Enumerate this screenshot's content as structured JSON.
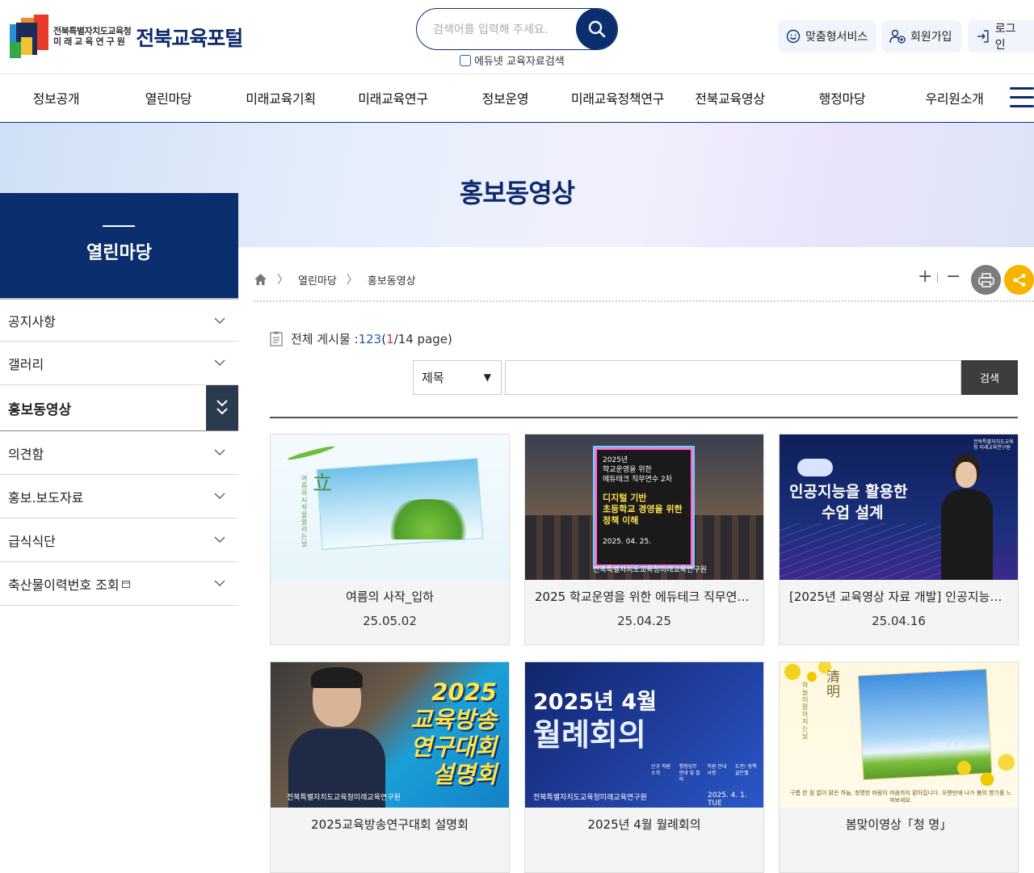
{
  "header": {
    "logo_org_line1": "전북특별자치도교육청",
    "logo_org_line2": "미래교육연구원",
    "logo_title": "전북교육포털",
    "search_placeholder": "검색어를 입력해 주세요.",
    "edunet_label": "에듀넷 교육자료검색",
    "util": {
      "custom_service": "맞춤형서비스",
      "join": "회원가입",
      "login": "로그인"
    }
  },
  "gnb": [
    "정보공개",
    "열린마당",
    "미래교육기획",
    "미래교육연구",
    "정보운영",
    "미래교육정책연구",
    "전북교육영상",
    "행정마당",
    "우리원소개"
  ],
  "visual_title": "홍보동영상",
  "lnb": {
    "title": "열린마당",
    "items": [
      "공지사항",
      "갤러리",
      "홍보동영상",
      "의견함",
      "홍보.보도자료",
      "급식식단",
      "축산물이력번호 조회"
    ]
  },
  "breadcrumb": [
    "열린마당",
    "홍보동영상"
  ],
  "board": {
    "total_label": "전체 게시물 :",
    "total_count": "123",
    "page_open": "(",
    "current_page": "1",
    "page_rest": "/14 page)",
    "search_field": "제목",
    "search_button": "검색"
  },
  "cards": [
    {
      "title": "여름의 사작_입하",
      "date": "25.05.02"
    },
    {
      "title": "2025 학교운영을 위한 에듀테크 직무연수 2차",
      "date": "25.04.25"
    },
    {
      "title": "[2025년 교육영상 자료 개발] 인공지능을 활용한 수업 설계",
      "date": "25.04.16"
    },
    {
      "title": "2025교육방송연구대회 설명회",
      "date": ""
    },
    {
      "title": "2025년 4월 월례회의",
      "date": ""
    },
    {
      "title": "봄맞이영상「청 명」",
      "date": ""
    }
  ],
  "thumbs": {
    "t1_char": "立",
    "t1_vertical": "여름의 시작을 알리는 날",
    "t2_lines": [
      "2025년",
      "학교운영을 위한",
      "에듀테크 직무연수 2차"
    ],
    "t2_highlight": [
      "디지털 기반",
      "초등학교 경영을 위한",
      "정책 이해"
    ],
    "t2_date": "2025. 04. 25.",
    "t2_caption": "전북특별자치도교육청미래교육연구원",
    "t3_title": [
      "인공지능을 활용한",
      "수업 설계"
    ],
    "t3_badge": "전북특별자치도교육청 미래교육연구원",
    "t4_title": [
      "2025",
      "교육방송",
      "연구대회",
      "설명회"
    ],
    "t4_caption": "전북특별자치도교육청미래교육연구원",
    "t5_title": [
      "2025년 4월",
      "월례회의"
    ],
    "t5_items": [
      "신규 직원 소개",
      "행정업무 안내 및 질의",
      "직원 안내사항",
      "도전! 정책골든벨"
    ],
    "t5_caption": "전북특별자치도교육청미래교육연구원",
    "t5_date": "2025. 4. 1. TUE",
    "t6_chars": "清明",
    "t6_vertical": "하늘이 맑아지는 날",
    "t6_date": "2025. 4. 4.",
    "t6_caption": "구름 한 점 없이 맑은 하늘, 청명한 바람이 마음까지 맑아집니다. 오랜만에 나가 봄의 향기를 느껴보세요."
  },
  "colors": {
    "navy": "#0b2f6e",
    "share": "#f6b400",
    "print": "#7c7c7c",
    "count": "#1c5cb0",
    "page": "#d32f2f"
  },
  "icons": [
    "search-icon",
    "smile-icon",
    "user-add-icon",
    "login-icon",
    "menu-icon",
    "home-icon",
    "chevron-down-icon",
    "double-chevron-down-icon",
    "print-icon",
    "share-icon",
    "board-icon",
    "new-window-icon"
  ]
}
